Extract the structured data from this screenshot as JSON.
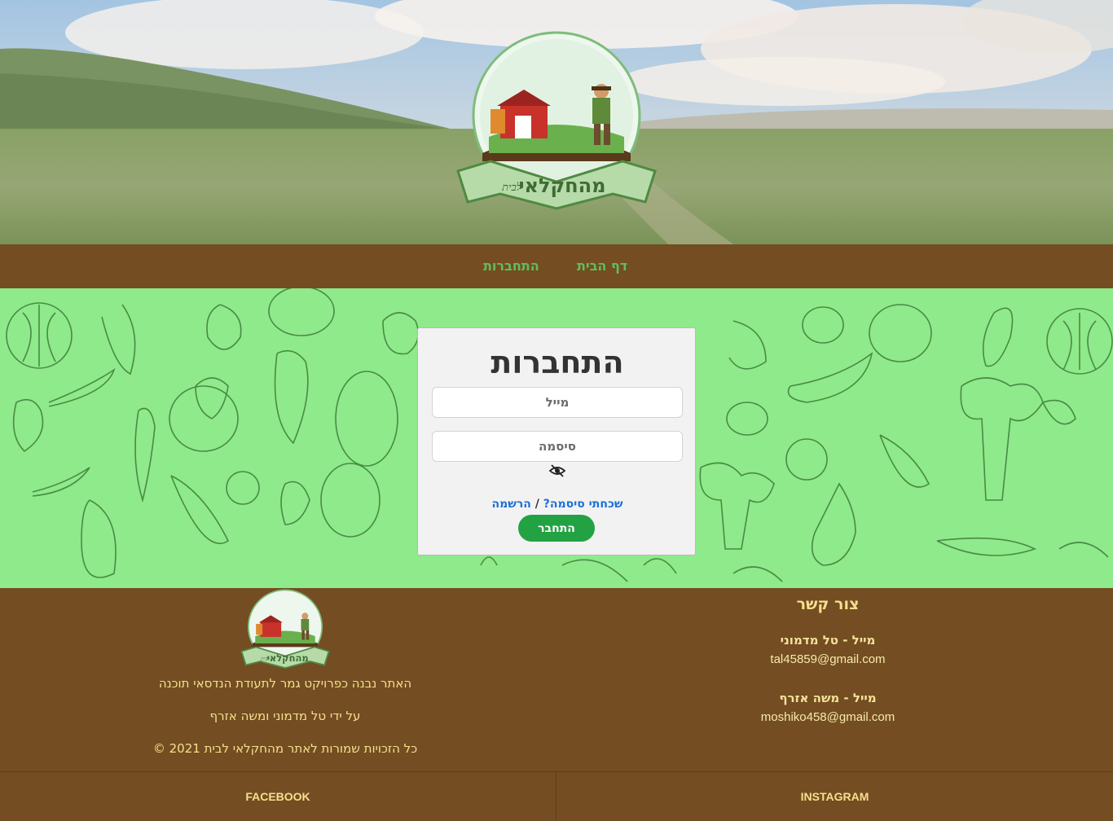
{
  "brand": {
    "logo_text": "מהחקלאי",
    "logo_subtext": "לבית"
  },
  "nav": {
    "home": "דף הבית",
    "login": "התחברות"
  },
  "login_card": {
    "title": "התחברות",
    "email_placeholder": "מייל",
    "password_placeholder": "סיסמה",
    "show_password_icon": "eye-slash-icon",
    "forgot_link": "שכחתי סיסמה?",
    "separator": " / ",
    "register_link": "הרשמה",
    "submit_label": "התחבר"
  },
  "footer": {
    "contact": {
      "title": "צור קשר",
      "people": [
        {
          "label": "מייל - טל מדמוני",
          "email": "tal45859@gmail.com"
        },
        {
          "label": "מייל - משה אזרף",
          "email": "moshiko458@gmail.com"
        }
      ]
    },
    "about": {
      "line1": "האתר נבנה כפרויקט גמר לתעודת הנדסאי תוכנה",
      "line2": "על ידי טל מדמוני ומשה אזרף",
      "line3": "כל הזכויות שמורות לאתר מהחקלאי לבית  2021  ©"
    },
    "social": {
      "facebook": "FACEBOOK",
      "instagram": "INSTAGRAM"
    }
  },
  "colors": {
    "brown": "#744d22",
    "green_bg": "#8eea8a",
    "nav_link": "#5fbf5a",
    "submit": "#23a244",
    "footer_text": "#f3e39a"
  }
}
